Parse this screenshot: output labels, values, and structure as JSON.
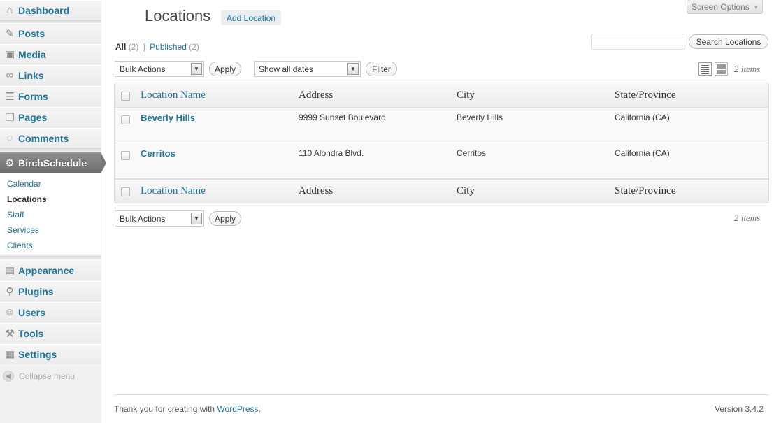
{
  "sidebar": {
    "items": [
      {
        "label": "Dashboard",
        "icon": "dashboard-icon"
      },
      {
        "label": "Posts",
        "icon": "pin-icon"
      },
      {
        "label": "Media",
        "icon": "media-icon"
      },
      {
        "label": "Links",
        "icon": "link-icon"
      },
      {
        "label": "Forms",
        "icon": "form-icon"
      },
      {
        "label": "Pages",
        "icon": "pages-icon"
      },
      {
        "label": "Comments",
        "icon": "comment-icon"
      },
      {
        "label": "BirchSchedule",
        "icon": "gear-icon"
      },
      {
        "label": "Appearance",
        "icon": "appearance-icon"
      },
      {
        "label": "Plugins",
        "icon": "plugin-icon"
      },
      {
        "label": "Users",
        "icon": "users-icon"
      },
      {
        "label": "Tools",
        "icon": "tools-icon"
      },
      {
        "label": "Settings",
        "icon": "settings-icon"
      }
    ],
    "submenu": [
      "Calendar",
      "Locations",
      "Staff",
      "Services",
      "Clients"
    ],
    "collapse_label": "Collapse menu"
  },
  "header": {
    "screen_options": "Screen Options",
    "title": "Locations",
    "add_new": "Add Location"
  },
  "filters": {
    "all_label": "All",
    "all_count": "(2)",
    "published_label": "Published",
    "published_count": "(2)",
    "separator": "|"
  },
  "search": {
    "placeholder": "",
    "button": "Search Locations"
  },
  "toolbar": {
    "bulk_actions": "Bulk Actions",
    "apply": "Apply",
    "dates": "Show all dates",
    "filter": "Filter",
    "items_count": "2 items"
  },
  "table": {
    "columns": [
      "Location Name",
      "Address",
      "City",
      "State/Province"
    ],
    "rows": [
      [
        "Beverly Hills",
        "9999 Sunset Boulevard",
        "Beverly Hills",
        "California (CA)"
      ],
      [
        "Cerritos",
        "110 Alondra Blvd.",
        "Cerritos",
        "California (CA)"
      ]
    ]
  },
  "footer": {
    "thanks": "Thank you for creating with",
    "wordpress": "WordPress",
    "period": ".",
    "version": "Version 3.4.2"
  },
  "colors": {
    "link": "#21759b",
    "active_menu": "#7a7a7a"
  }
}
